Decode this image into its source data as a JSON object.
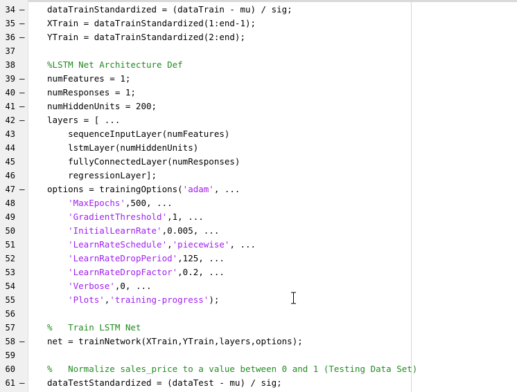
{
  "colors": {
    "code": "#000000",
    "string": "#a020f0",
    "comment": "#228b22",
    "gutter": "#f0f0f0"
  },
  "cursor_icon": "text-ibeam-icon",
  "lines": [
    {
      "num": "34",
      "dash": "–",
      "parts": [
        {
          "t": "k",
          "text": "dataTrainStandardized = (dataTrain - mu) / sig;"
        }
      ]
    },
    {
      "num": "35",
      "dash": "–",
      "parts": [
        {
          "t": "k",
          "text": "XTrain = dataTrainStandardized(1:end-1);"
        }
      ]
    },
    {
      "num": "36",
      "dash": "–",
      "parts": [
        {
          "t": "k",
          "text": "YTrain = dataTrainStandardized(2:end);"
        }
      ]
    },
    {
      "num": "37",
      "dash": "",
      "parts": []
    },
    {
      "num": "38",
      "dash": "",
      "parts": [
        {
          "t": "c",
          "text": "%LSTM Net Architecture Def"
        }
      ]
    },
    {
      "num": "39",
      "dash": "–",
      "parts": [
        {
          "t": "k",
          "text": "numFeatures = 1;"
        }
      ]
    },
    {
      "num": "40",
      "dash": "–",
      "parts": [
        {
          "t": "k",
          "text": "numResponses = 1;"
        }
      ]
    },
    {
      "num": "41",
      "dash": "–",
      "parts": [
        {
          "t": "k",
          "text": "numHiddenUnits = 200;"
        }
      ]
    },
    {
      "num": "42",
      "dash": "–",
      "parts": [
        {
          "t": "k",
          "text": "layers = [ ..."
        }
      ]
    },
    {
      "num": "43",
      "dash": "",
      "parts": [
        {
          "t": "k",
          "text": "    sequenceInputLayer(numFeatures)"
        }
      ]
    },
    {
      "num": "44",
      "dash": "",
      "parts": [
        {
          "t": "k",
          "text": "    lstmLayer(numHiddenUnits)"
        }
      ]
    },
    {
      "num": "45",
      "dash": "",
      "parts": [
        {
          "t": "k",
          "text": "    fullyConnectedLayer(numResponses)"
        }
      ]
    },
    {
      "num": "46",
      "dash": "",
      "parts": [
        {
          "t": "k",
          "text": "    regressionLayer];"
        }
      ]
    },
    {
      "num": "47",
      "dash": "–",
      "parts": [
        {
          "t": "k",
          "text": "options = trainingOptions("
        },
        {
          "t": "s",
          "text": "'adam'"
        },
        {
          "t": "k",
          "text": ", ..."
        }
      ]
    },
    {
      "num": "48",
      "dash": "",
      "parts": [
        {
          "t": "k",
          "text": "    "
        },
        {
          "t": "s",
          "text": "'MaxEpochs'"
        },
        {
          "t": "k",
          "text": ",500, ..."
        }
      ]
    },
    {
      "num": "49",
      "dash": "",
      "parts": [
        {
          "t": "k",
          "text": "    "
        },
        {
          "t": "s",
          "text": "'GradientThreshold'"
        },
        {
          "t": "k",
          "text": ",1, ..."
        }
      ]
    },
    {
      "num": "50",
      "dash": "",
      "parts": [
        {
          "t": "k",
          "text": "    "
        },
        {
          "t": "s",
          "text": "'InitialLearnRate'"
        },
        {
          "t": "k",
          "text": ",0.005, ..."
        }
      ]
    },
    {
      "num": "51",
      "dash": "",
      "parts": [
        {
          "t": "k",
          "text": "    "
        },
        {
          "t": "s",
          "text": "'LearnRateSchedule'"
        },
        {
          "t": "k",
          "text": ","
        },
        {
          "t": "s",
          "text": "'piecewise'"
        },
        {
          "t": "k",
          "text": ", ..."
        }
      ]
    },
    {
      "num": "52",
      "dash": "",
      "parts": [
        {
          "t": "k",
          "text": "    "
        },
        {
          "t": "s",
          "text": "'LearnRateDropPeriod'"
        },
        {
          "t": "k",
          "text": ",125, ..."
        }
      ]
    },
    {
      "num": "53",
      "dash": "",
      "parts": [
        {
          "t": "k",
          "text": "    "
        },
        {
          "t": "s",
          "text": "'LearnRateDropFactor'"
        },
        {
          "t": "k",
          "text": ",0.2, ..."
        }
      ]
    },
    {
      "num": "54",
      "dash": "",
      "parts": [
        {
          "t": "k",
          "text": "    "
        },
        {
          "t": "s",
          "text": "'Verbose'"
        },
        {
          "t": "k",
          "text": ",0, ..."
        }
      ]
    },
    {
      "num": "55",
      "dash": "",
      "parts": [
        {
          "t": "k",
          "text": "    "
        },
        {
          "t": "s",
          "text": "'Plots'"
        },
        {
          "t": "k",
          "text": ","
        },
        {
          "t": "s",
          "text": "'training-progress'"
        },
        {
          "t": "k",
          "text": ");"
        }
      ]
    },
    {
      "num": "56",
      "dash": "",
      "parts": []
    },
    {
      "num": "57",
      "dash": "",
      "parts": [
        {
          "t": "c",
          "text": "%   Train LSTM Net"
        }
      ]
    },
    {
      "num": "58",
      "dash": "–",
      "parts": [
        {
          "t": "k",
          "text": "net = trainNetwork(XTrain,YTrain,layers,options);"
        }
      ]
    },
    {
      "num": "59",
      "dash": "",
      "parts": []
    },
    {
      "num": "60",
      "dash": "",
      "parts": [
        {
          "t": "c",
          "text": "%   Normalize sales_price to a value between 0 and 1 (Testing Data Set)"
        }
      ]
    },
    {
      "num": "61",
      "dash": "–",
      "parts": [
        {
          "t": "k",
          "text": "dataTestStandardized = (dataTest - mu) / sig;"
        }
      ]
    }
  ]
}
